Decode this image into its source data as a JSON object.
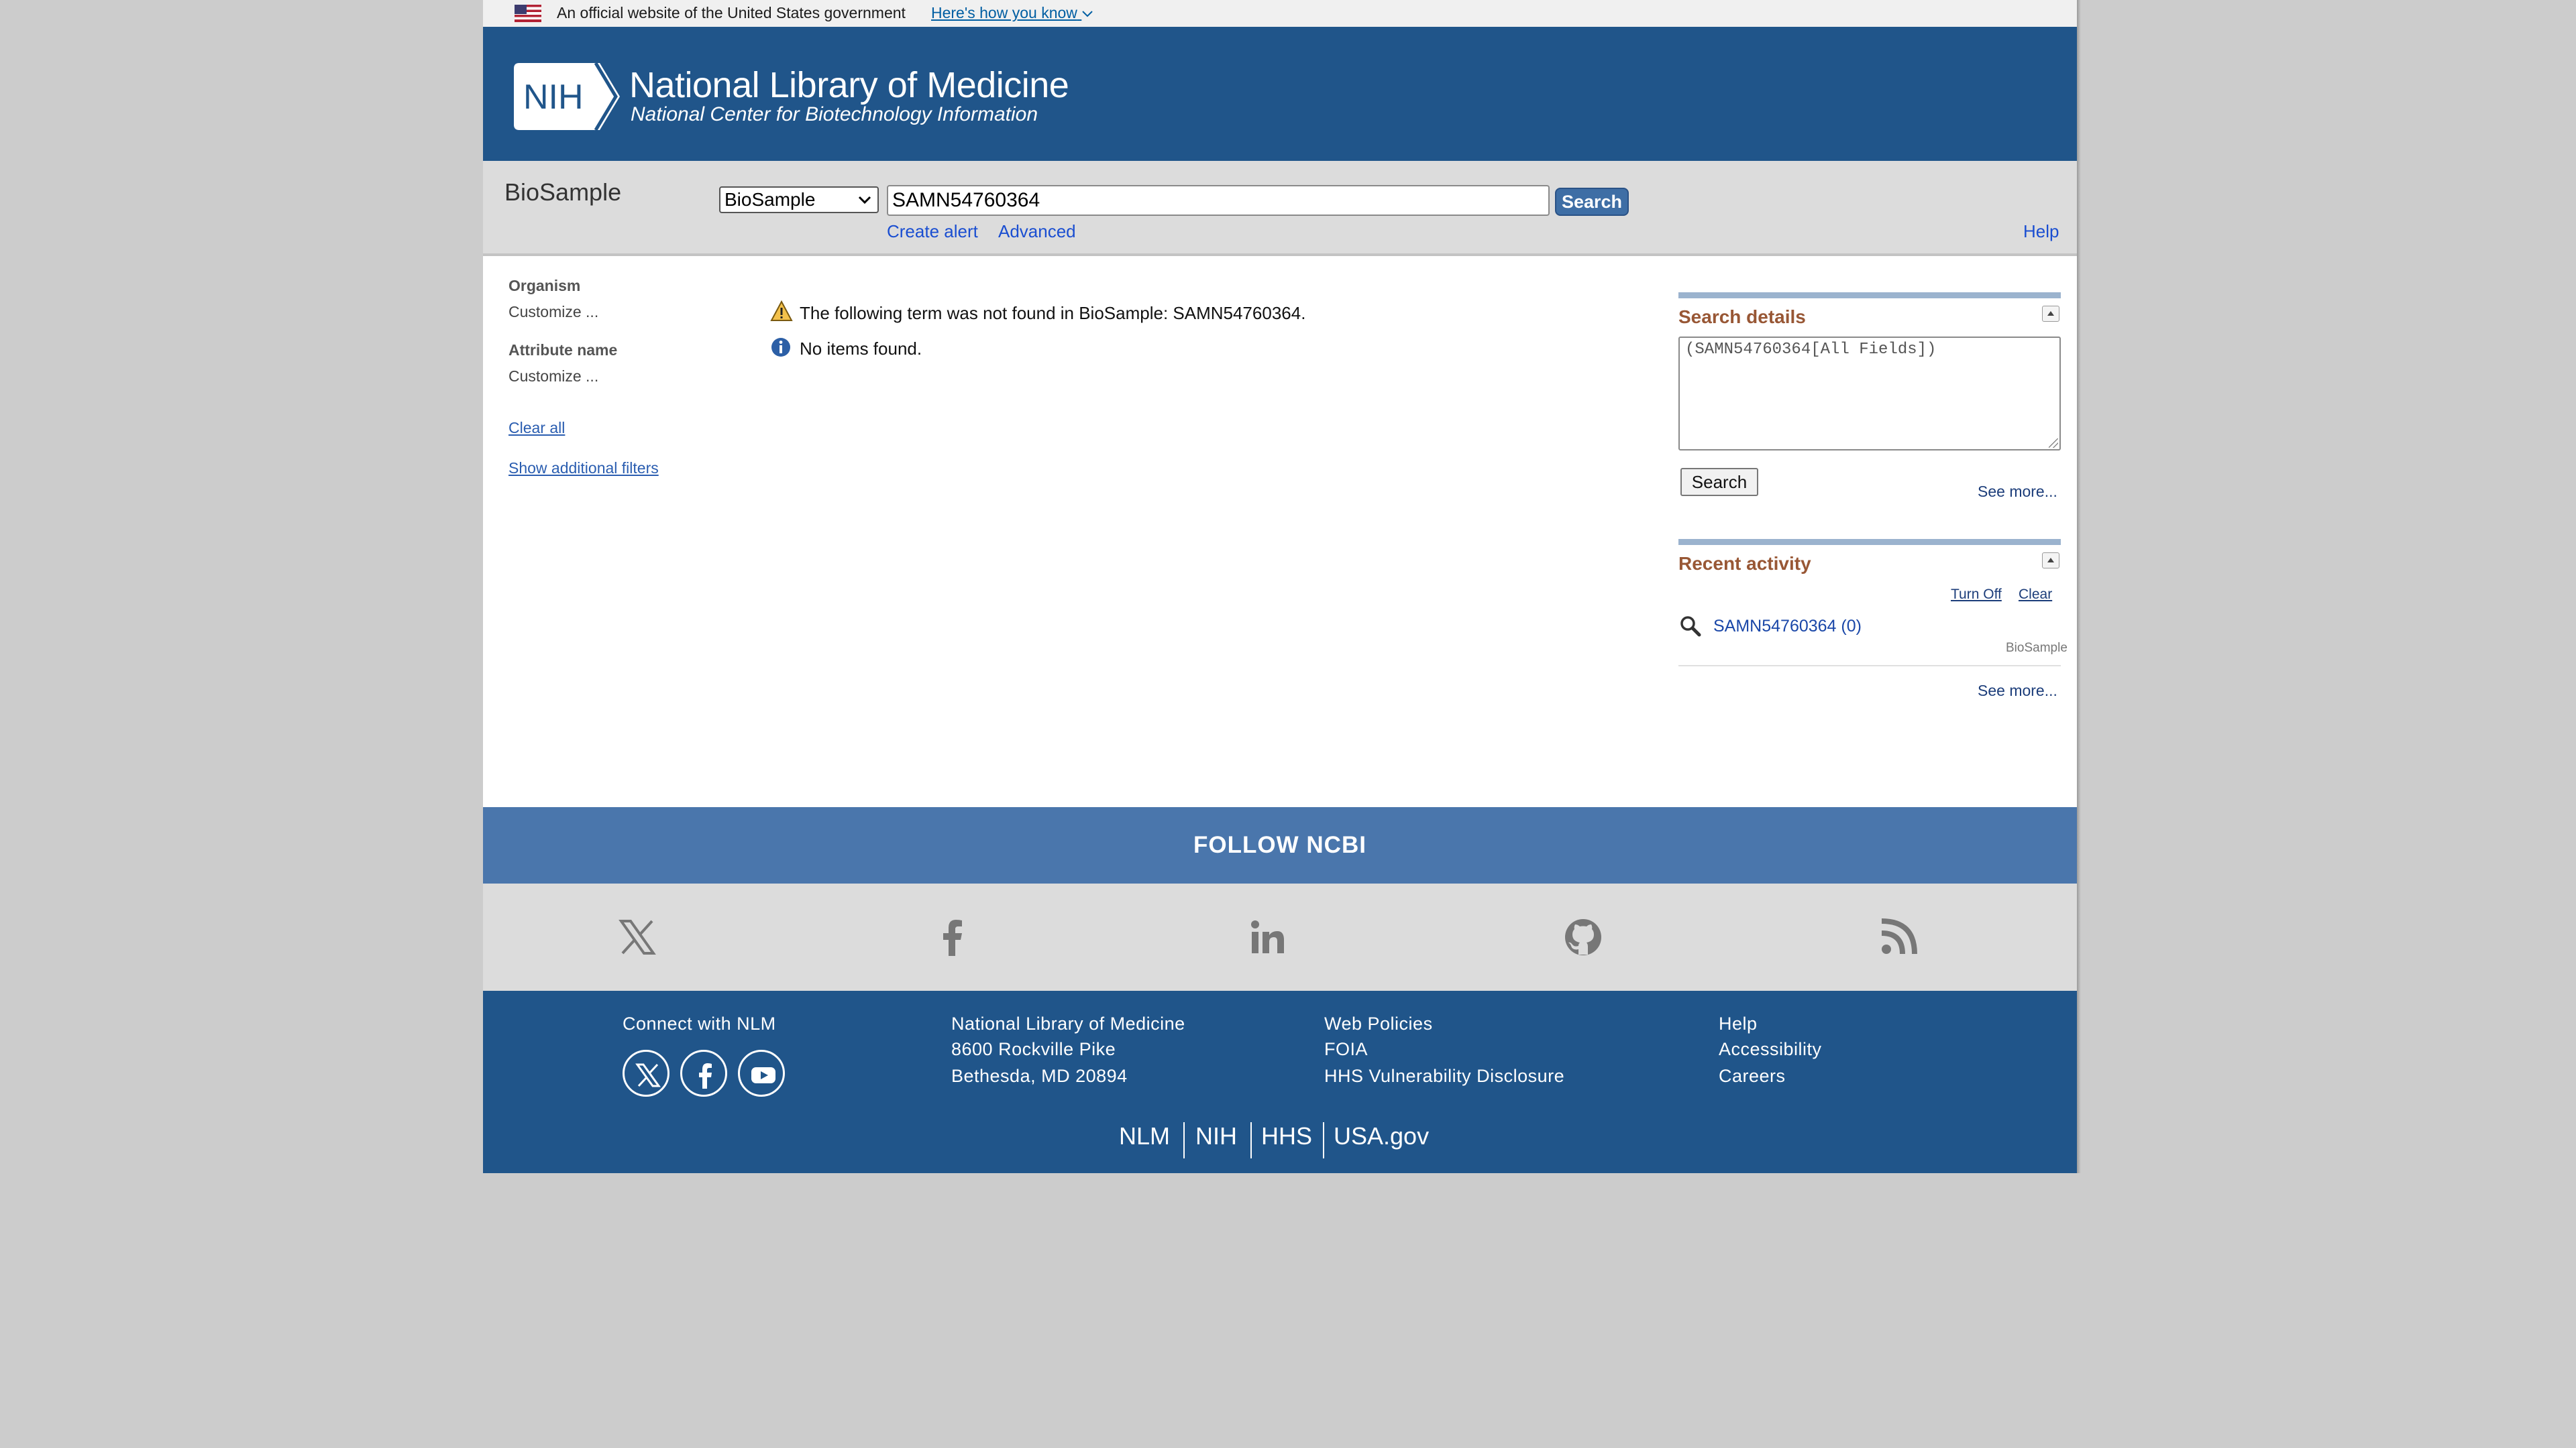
{
  "gov_banner": {
    "text": "An official website of the United States government",
    "link": "Here's how you know"
  },
  "header": {
    "logo_text": "NIH",
    "title": "National Library of Medicine",
    "subtitle": "National Center for Biotechnology Information"
  },
  "search": {
    "db_name": "BioSample",
    "db_selected": "BioSample",
    "term": "SAMN54760364",
    "button": "Search",
    "create_alert": "Create alert",
    "advanced": "Advanced",
    "help": "Help"
  },
  "filters": {
    "organism_heading": "Organism",
    "organism_customize": "Customize ...",
    "attribute_heading": "Attribute name",
    "attribute_customize": "Customize ...",
    "clear_all": "Clear all",
    "show_additional": "Show additional filters"
  },
  "messages": {
    "warning": "The following term was not found in BioSample: SAMN54760364.",
    "info": "No items found."
  },
  "search_details": {
    "title": "Search details",
    "query": "(SAMN54760364[All Fields])",
    "button": "Search",
    "see_more": "See more..."
  },
  "recent_activity": {
    "title": "Recent activity",
    "turn_off": "Turn Off",
    "clear": "Clear",
    "entry": "SAMN54760364 (0)",
    "entry_db": "BioSample",
    "see_more": "See more..."
  },
  "follow": {
    "title": "FOLLOW NCBI",
    "icons": [
      "x-icon",
      "facebook-icon",
      "linkedin-icon",
      "github-icon",
      "rss-icon"
    ]
  },
  "footer": {
    "connect": "Connect with NLM",
    "address": [
      "National Library of Medicine",
      "8600 Rockville Pike",
      "Bethesda, MD 20894"
    ],
    "policies": [
      "Web Policies",
      "FOIA",
      "HHS Vulnerability Disclosure"
    ],
    "help_links": [
      "Help",
      "Accessibility",
      "Careers"
    ],
    "bottom_links": [
      "NLM",
      "NIH",
      "HHS",
      "USA.gov"
    ]
  },
  "colors": {
    "header_blue": "#20558a",
    "follow_blue": "#4a76ac",
    "portlet_title": "#985735",
    "page_bg": "#cccccc"
  }
}
